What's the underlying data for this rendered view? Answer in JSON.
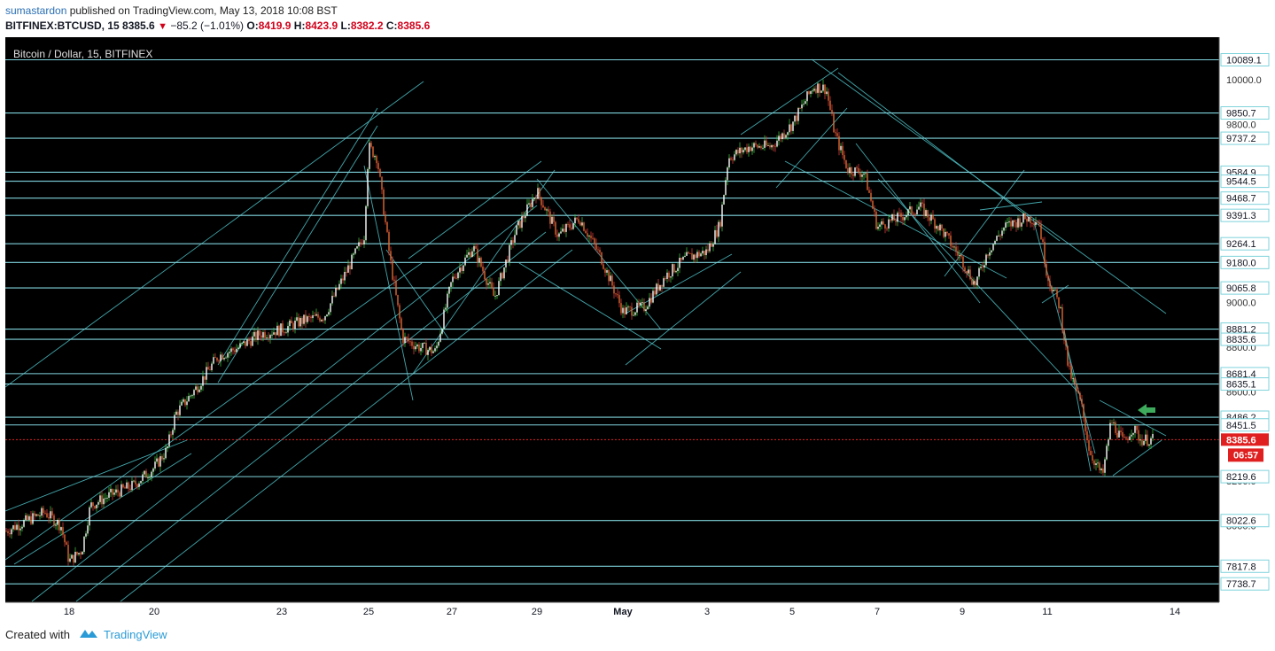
{
  "header": {
    "author": "sumastardon",
    "published_text": " published on TradingView.com, May 13, 2018 10:08 BST",
    "symbol": "BITFINEX:BTCUSD, 15",
    "last": "8385.6",
    "change": "−85.2 (−1.01%)",
    "o_label": "O:",
    "o_value": "8419.9",
    "h_label": "H:",
    "h_value": "8423.9",
    "l_label": "L:",
    "l_value": "8382.2",
    "c_label": "C:",
    "c_value": "8385.6"
  },
  "footer": {
    "created_with": "Created with",
    "brand": "TradingView"
  },
  "chart_data": {
    "type": "line",
    "title": "Bitcoin / Dollar, 15, BITFINEX",
    "ylim": [
      7700,
      10130
    ],
    "x_ticks": [
      "18",
      "20",
      "23",
      "25",
      "27",
      "29",
      "May",
      "3",
      "5",
      "7",
      "9",
      "11",
      "14"
    ],
    "horizontal_levels": [
      10089.1,
      9850.7,
      9737.2,
      9584.9,
      9544.5,
      9468.7,
      9391.3,
      9264.1,
      9180.0,
      9065.8,
      8881.2,
      8835.6,
      8681.4,
      8635.1,
      8486.2,
      8451.5,
      8219.6,
      8022.6,
      7817.8,
      7738.7
    ],
    "level_labels": [
      "10089.1",
      "9850.7",
      "9737.2",
      "9584.9",
      "9544.5",
      "9468.7",
      "9391.3",
      "9264.1",
      "9180.0",
      "9065.8",
      "8881.2",
      "8835.6",
      "8681.4",
      "8635.1",
      "8486.2",
      "8451.5",
      "8219.6",
      "8022.6",
      "7817.8",
      "7738.7"
    ],
    "axis_ticks": [
      "10000.0",
      "9800.0",
      "9000.0",
      "8800.0",
      "8600.0",
      "8200.0",
      "8000.0"
    ],
    "current_price": "8385.6",
    "countdown": "06:57",
    "price_path": [
      {
        "x": "17",
        "y": 7930
      },
      {
        "x": "17.3",
        "y": 7990
      },
      {
        "x": "17.7",
        "y": 8060
      },
      {
        "x": "17.9",
        "y": 8000
      },
      {
        "x": "18",
        "y": 7840
      },
      {
        "x": "18.3",
        "y": 7890
      },
      {
        "x": "18.5",
        "y": 8090
      },
      {
        "x": "19",
        "y": 8140
      },
      {
        "x": "19.5",
        "y": 8180
      },
      {
        "x": "20",
        "y": 8260
      },
      {
        "x": "20.3",
        "y": 8340
      },
      {
        "x": "20.5",
        "y": 8500
      },
      {
        "x": "21",
        "y": 8620
      },
      {
        "x": "21.5",
        "y": 8760
      },
      {
        "x": "22",
        "y": 8800
      },
      {
        "x": "22.5",
        "y": 8860
      },
      {
        "x": "23",
        "y": 8880
      },
      {
        "x": "23.5",
        "y": 8920
      },
      {
        "x": "24",
        "y": 8940
      },
      {
        "x": "24.5",
        "y": 9140
      },
      {
        "x": "24.9",
        "y": 9300
      },
      {
        "x": "25",
        "y": 9700
      },
      {
        "x": "25.2",
        "y": 9650
      },
      {
        "x": "25.5",
        "y": 9200
      },
      {
        "x": "25.8",
        "y": 8840
      },
      {
        "x": "26.2",
        "y": 8800
      },
      {
        "x": "26.6",
        "y": 8780
      },
      {
        "x": "27",
        "y": 9100
      },
      {
        "x": "27.5",
        "y": 9250
      },
      {
        "x": "28",
        "y": 9020
      },
      {
        "x": "28.5",
        "y": 9320
      },
      {
        "x": "29",
        "y": 9500
      },
      {
        "x": "29.5",
        "y": 9300
      },
      {
        "x": "30",
        "y": 9380
      },
      {
        "x": "30.5",
        "y": 9200
      },
      {
        "x": "1",
        "y": 8960
      },
      {
        "x": "1.5",
        "y": 8980
      },
      {
        "x": "2",
        "y": 9120
      },
      {
        "x": "2.5",
        "y": 9200
      },
      {
        "x": "3",
        "y": 9230
      },
      {
        "x": "3.3",
        "y": 9350
      },
      {
        "x": "3.5",
        "y": 9650
      },
      {
        "x": "4",
        "y": 9700
      },
      {
        "x": "4.5",
        "y": 9700
      },
      {
        "x": "5",
        "y": 9800
      },
      {
        "x": "5.5",
        "y": 9970
      },
      {
        "x": "5.8",
        "y": 9960
      },
      {
        "x": "6",
        "y": 9760
      },
      {
        "x": "6.3",
        "y": 9600
      },
      {
        "x": "6.7",
        "y": 9580
      },
      {
        "x": "7",
        "y": 9340
      },
      {
        "x": "7.5",
        "y": 9380
      },
      {
        "x": "8",
        "y": 9430
      },
      {
        "x": "8.5",
        "y": 9330
      },
      {
        "x": "9",
        "y": 9190
      },
      {
        "x": "9.3",
        "y": 9080
      },
      {
        "x": "9.6",
        "y": 9230
      },
      {
        "x": "10",
        "y": 9340
      },
      {
        "x": "10.5",
        "y": 9380
      },
      {
        "x": "10.8",
        "y": 9370
      },
      {
        "x": "11",
        "y": 9120
      },
      {
        "x": "11.3",
        "y": 8980
      },
      {
        "x": "11.5",
        "y": 8700
      },
      {
        "x": "11.8",
        "y": 8540
      },
      {
        "x": "12",
        "y": 8330
      },
      {
        "x": "12.3",
        "y": 8220
      },
      {
        "x": "12.5",
        "y": 8470
      },
      {
        "x": "12.8",
        "y": 8370
      },
      {
        "x": "13",
        "y": 8440
      },
      {
        "x": "13.2",
        "y": 8385.6
      }
    ]
  }
}
